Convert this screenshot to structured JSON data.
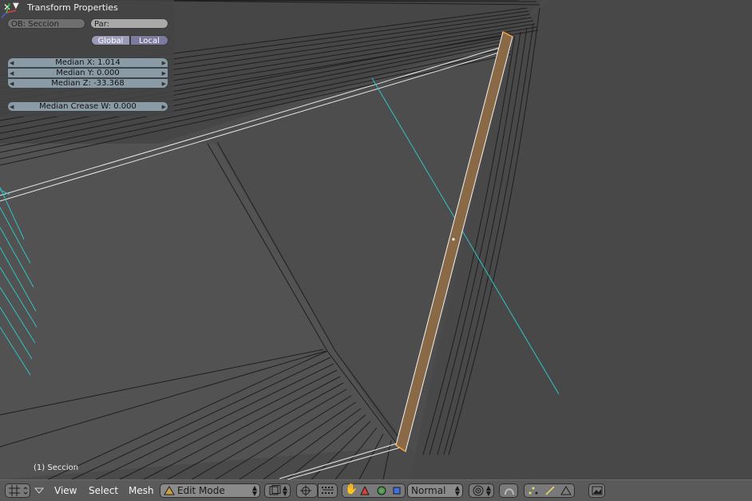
{
  "panel": {
    "title": "Transform Properties",
    "close_glyph": "✕",
    "collapse_glyph": "▼",
    "ob_field": "OB: Seccion",
    "par_field": "Par:",
    "global_label": "Global",
    "local_label": "Local",
    "median_x": "Median X: 1.014",
    "median_y": "Median Y: 0.000",
    "median_z": "Median Z: -33.368",
    "median_crease": "Median Crease W: 0.000"
  },
  "viewport": {
    "object_label": "(1) Seccion"
  },
  "header": {
    "menus": [
      "View",
      "Select",
      "Mesh"
    ],
    "mode_label": "Edit Mode",
    "orientation_label": "Normal"
  },
  "colors": {
    "viewport_bg": "#4a4a4a",
    "selected_face": "#8a6a46",
    "cyan_line": "#2ec4c4",
    "header_bg": "#5a5a5a"
  }
}
